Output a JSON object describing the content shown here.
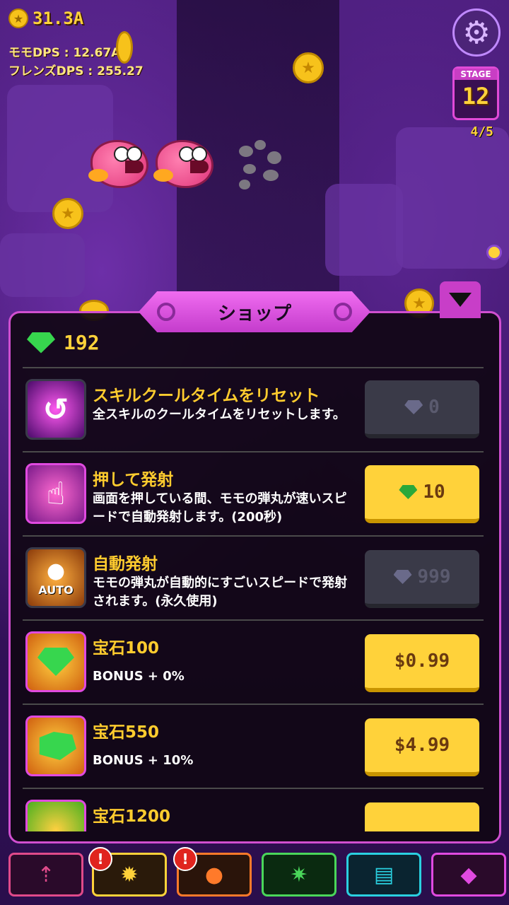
{
  "hud": {
    "gold": "31.3A",
    "momo_dps": "モモDPS : 12.67A",
    "friends_dps": "フレンズDPS : 255.27",
    "stage_label": "STAGE",
    "stage_number": "12",
    "stage_progress": "4/5"
  },
  "shop": {
    "title": "ショップ",
    "gems": "192",
    "items": [
      {
        "title": "スキルクールタイムをリセット",
        "desc": "全スキルのクールタイムをリセットします。",
        "price": "0",
        "price_type": "gem",
        "enabled": false
      },
      {
        "title": "押して発射",
        "desc": "画面を押している間、モモの弾丸が速いスピードで自動発射します。(200秒)",
        "price": "10",
        "price_type": "gem",
        "enabled": true
      },
      {
        "title": "自動発射",
        "desc": "モモの弾丸が自動的にすごいスピードで発射されます。(永久使用)",
        "price": "999",
        "price_type": "gem",
        "enabled": false,
        "icon_label": "AUTO"
      },
      {
        "title": "宝石100",
        "desc": "BONUS + 0%",
        "price": "$0.99",
        "price_type": "cash",
        "enabled": true
      },
      {
        "title": "宝石550",
        "desc": "BONUS + 10%",
        "price": "$4.99",
        "price_type": "cash",
        "enabled": true
      },
      {
        "title": "宝石1200",
        "desc": "",
        "price": "",
        "price_type": "cash",
        "enabled": true
      }
    ]
  },
  "colors": {
    "accent_pink": "#d04fd0",
    "gold": "#ffd23a",
    "gem_green": "#37d64e"
  },
  "nav": [
    {
      "name": "upgrade-momo",
      "icon": "cannon-arrow-icon",
      "color": "#e04a8a",
      "alert": false
    },
    {
      "name": "skills",
      "icon": "sun-skill-icon",
      "color": "#ffd23a",
      "alert": true
    },
    {
      "name": "friends",
      "icon": "bomb-friend-icon",
      "color": "#ff7a2a",
      "alert": true
    },
    {
      "name": "boss",
      "icon": "spiky-monster-icon",
      "color": "#4ad65a",
      "alert": false
    },
    {
      "name": "quests",
      "icon": "scroll-icon",
      "color": "#2ad0e0",
      "alert": false
    },
    {
      "name": "shop",
      "icon": "gem-shop-icon",
      "color": "#e04ae0",
      "alert": false
    }
  ]
}
